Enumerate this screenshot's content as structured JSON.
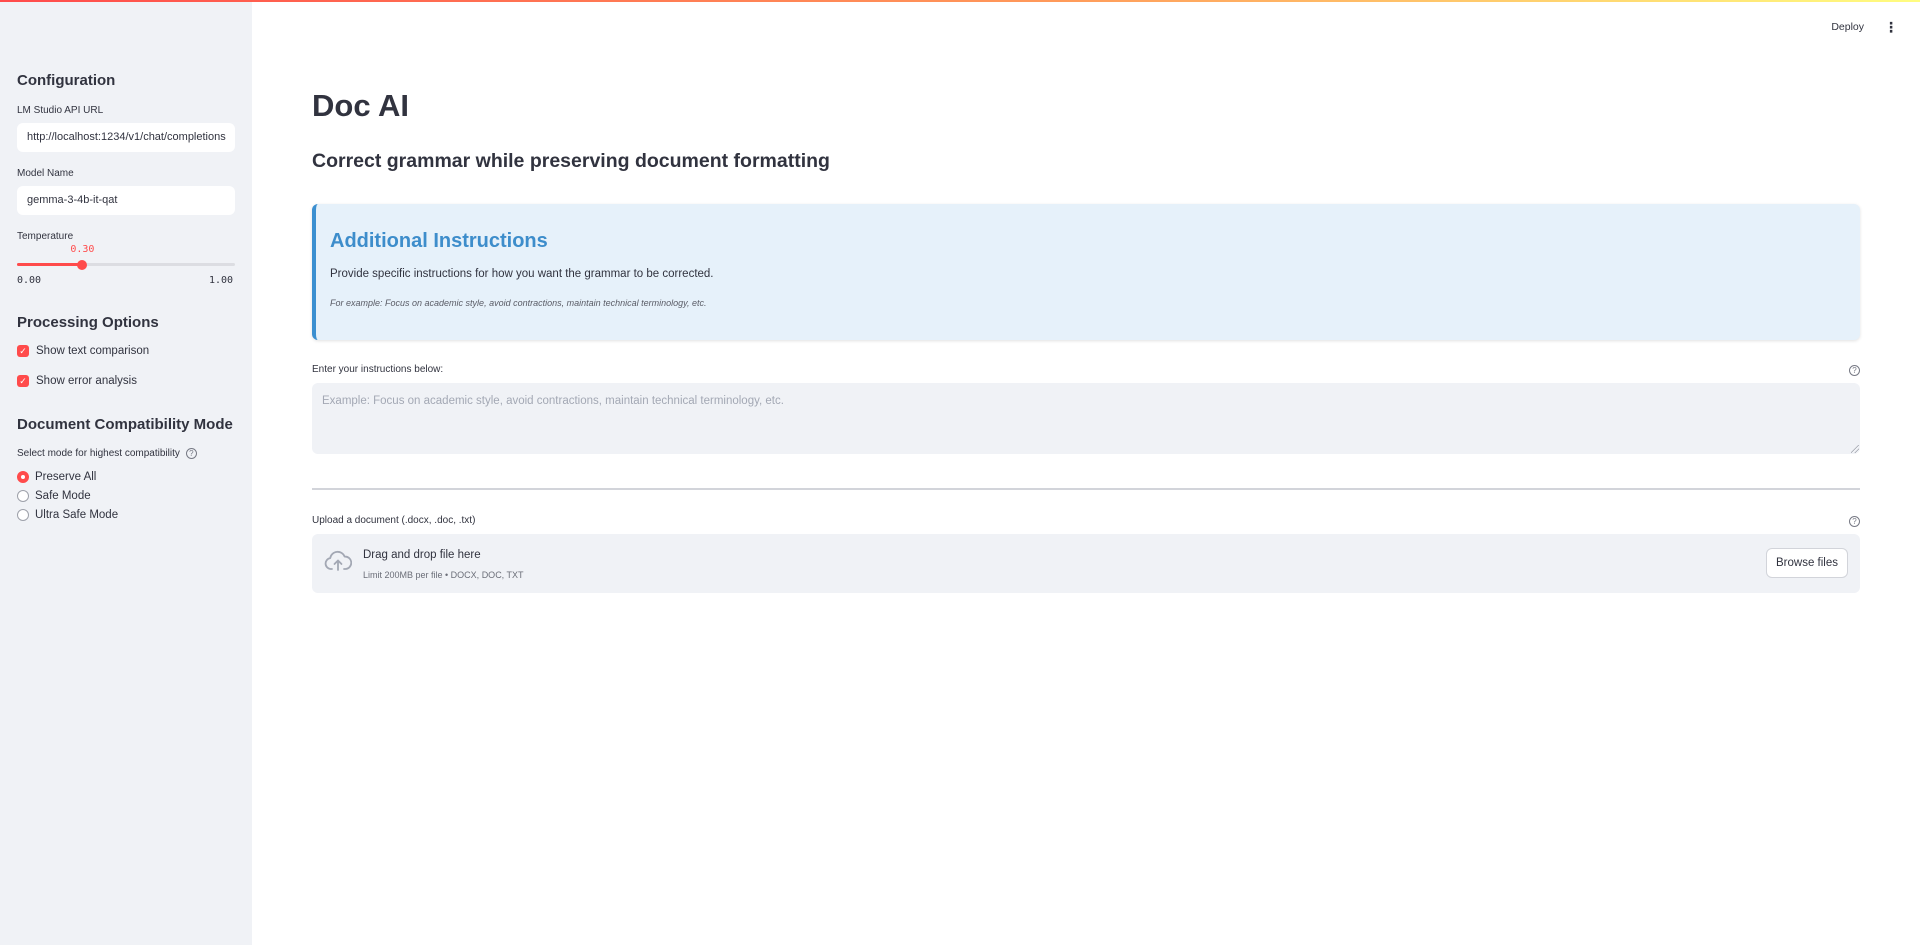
{
  "sidebar": {
    "configuration_heading": "Configuration",
    "api_url": {
      "label": "LM Studio API URL",
      "value": "http://localhost:1234/v1/chat/completions"
    },
    "model_name": {
      "label": "Model Name",
      "value": "gemma-3-4b-it-qat"
    },
    "temperature": {
      "label": "Temperature",
      "value": 0.3,
      "value_text": "0.30",
      "min": "0.00",
      "max": "1.00",
      "fraction": 0.3
    },
    "processing_heading": "Processing Options",
    "checkboxes": [
      {
        "label": "Show text comparison",
        "checked": true
      },
      {
        "label": "Show error analysis",
        "checked": true
      }
    ],
    "compat_heading": "Document Compatibility Mode",
    "compat_label": "Select mode for highest compatibility",
    "compat_options": [
      {
        "label": "Preserve All",
        "selected": true
      },
      {
        "label": "Safe Mode",
        "selected": false
      },
      {
        "label": "Ultra Safe Mode",
        "selected": false
      }
    ]
  },
  "header": {
    "deploy_label": "Deploy",
    "menu_icon": "more-vertical-icon"
  },
  "main": {
    "title": "Doc AI",
    "subtitle": "Correct grammar while preserving document formatting",
    "info": {
      "title": "Additional Instructions",
      "text": "Provide specific instructions for how you want the grammar to be corrected.",
      "example": "For example: Focus on academic style, avoid contractions, maintain technical terminology, etc."
    },
    "instructions": {
      "label": "Enter your instructions below:",
      "placeholder": "Example: Focus on academic style, avoid contractions, maintain technical terminology, etc."
    },
    "upload": {
      "label": "Upload a document (.docx, .doc, .txt)",
      "drag_text": "Drag and drop file here",
      "limit_text": "Limit 200MB per file • DOCX, DOC, TXT",
      "browse_label": "Browse files",
      "icon": "cloud-upload-icon"
    }
  },
  "colors": {
    "accent": "#ff4b4b",
    "info_bg": "#e6f1fa",
    "info_title": "#3d8dcb",
    "sidebar_bg": "#f0f2f6"
  }
}
